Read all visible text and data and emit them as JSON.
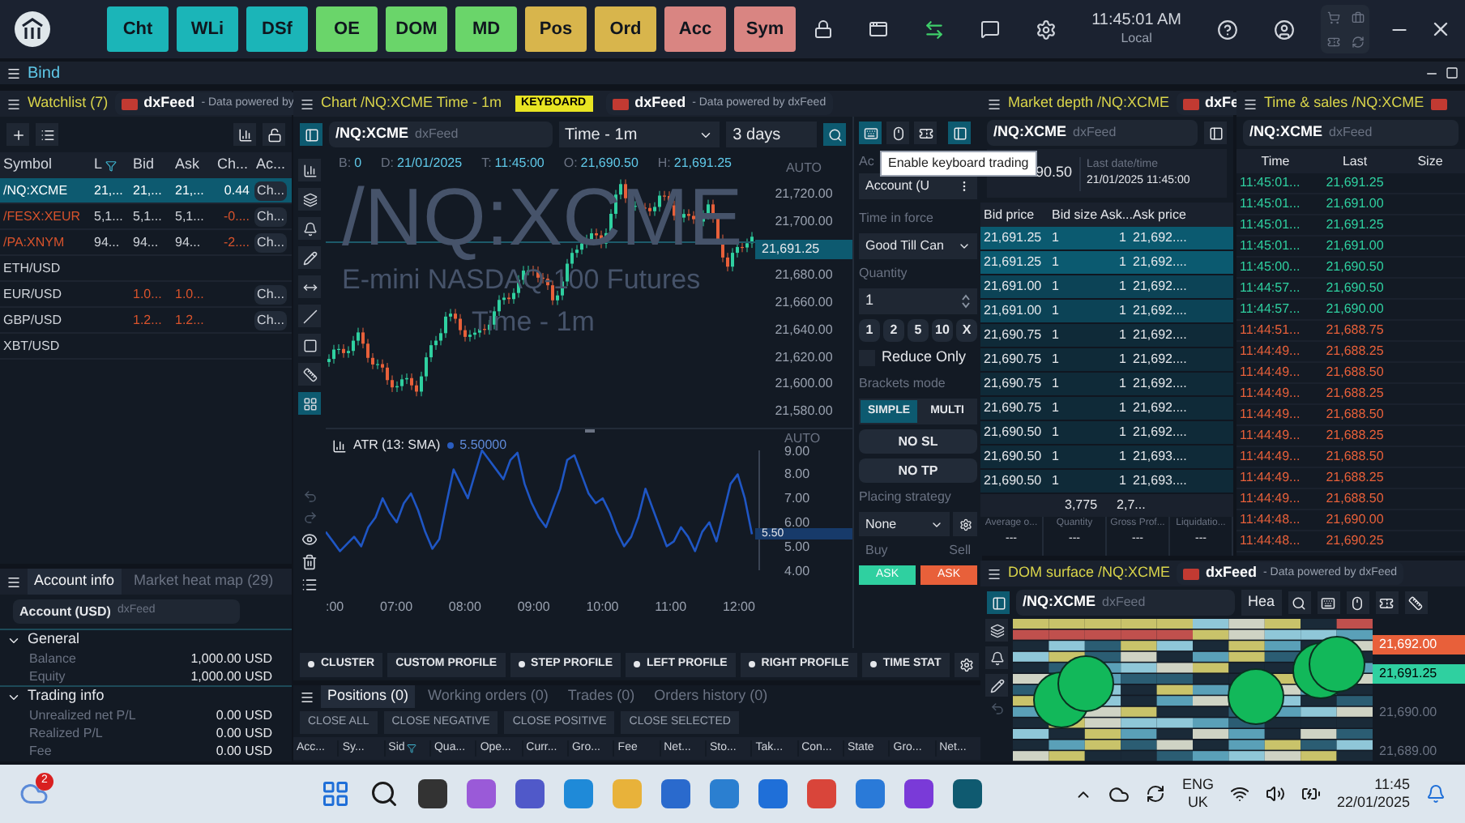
{
  "topbar": {
    "modules": [
      {
        "label": "Cht",
        "color": "#1bb5b8"
      },
      {
        "label": "WLi",
        "color": "#1bb5b8"
      },
      {
        "label": "DSf",
        "color": "#1bb5b8"
      },
      {
        "label": "OE",
        "color": "#6ad56a"
      },
      {
        "label": "DOM",
        "color": "#6ad56a"
      },
      {
        "label": "MD",
        "color": "#6ad56a"
      },
      {
        "label": "Pos",
        "color": "#d8b54c"
      },
      {
        "label": "Ord",
        "color": "#d8b54c"
      },
      {
        "label": "Acc",
        "color": "#d98582"
      },
      {
        "label": "Sym",
        "color": "#d98582"
      }
    ],
    "clock": {
      "time": "11:45:01 AM",
      "zone": "Local"
    }
  },
  "workspace": {
    "title": "Bind"
  },
  "watchlist": {
    "title": "Watchlist (7)",
    "feed": "dxFeed",
    "feed_note": "- Data powered by",
    "columns": [
      "Symbol",
      "L",
      "Bid",
      "Ask",
      "Ch...",
      "Ac..."
    ],
    "rows": [
      {
        "symbol": "/NQ:XCME",
        "last": "21,...",
        "bid": "21,...",
        "ask": "21,...",
        "change": "0.44",
        "action": "Ch...",
        "selected": true,
        "color": "#ffffff",
        "quote_down": false,
        "change_down": false
      },
      {
        "symbol": "/FESX:XEUR",
        "last": "5,1...",
        "bid": "5,1...",
        "ask": "5,1...",
        "change": "-0....",
        "action": "Ch...",
        "selected": false,
        "color": "#d8532c",
        "quote_down": false,
        "change_down": true
      },
      {
        "symbol": "/PA:XNYM",
        "last": "94...",
        "bid": "94...",
        "ask": "94...",
        "change": "-2....",
        "action": "Ch...",
        "selected": false,
        "color": "#d8532c",
        "quote_down": false,
        "change_down": true
      },
      {
        "symbol": "ETH/USD",
        "selected": false,
        "color": "#d0d4da"
      },
      {
        "symbol": "EUR/USD",
        "bid": "1.0...",
        "ask": "1.0...",
        "action": "Ch...",
        "selected": false,
        "color": "#d0d4da",
        "quote_down": true
      },
      {
        "symbol": "GBP/USD",
        "bid": "1.2...",
        "ask": "1.2...",
        "action": "Ch...",
        "selected": false,
        "color": "#d0d4da",
        "quote_down": true
      },
      {
        "symbol": "XBT/USD",
        "selected": false,
        "color": "#d0d4da"
      }
    ]
  },
  "account": {
    "tabs": [
      {
        "label": "Account info",
        "selected": true
      },
      {
        "label": "Market heat map (29)",
        "selected": false
      }
    ],
    "account": "Account (USD)",
    "source": "dxFeed",
    "groups": [
      {
        "title": "General",
        "expanded": true,
        "items": [
          {
            "label": "Balance",
            "value": "1,000.00 USD"
          },
          {
            "label": "Equity",
            "value": "1,000.00 USD"
          }
        ]
      },
      {
        "title": "Trading info",
        "expanded": true,
        "items": [
          {
            "label": "Unrealized net P/L",
            "value": "0.00 USD"
          },
          {
            "label": "Realized P/L",
            "value": "0.00 USD"
          },
          {
            "label": "Fee",
            "value": "0.00 USD"
          }
        ]
      }
    ]
  },
  "chart": {
    "title": "Chart /NQ:XCME Time - 1m",
    "badge": "KEYBOARD",
    "feed": "dxFeed",
    "feed_note": "- Data powered by dxFeed",
    "symbol": "/NQ:XCME",
    "symbol_source": "dxFeed",
    "interval": "Time - 1m",
    "range": "3 days",
    "info": [
      {
        "key": "B:",
        "value": "0"
      },
      {
        "key": "D:",
        "value": "21/01/2025"
      },
      {
        "key": "T:",
        "value": "11:45:00"
      },
      {
        "key": "O:",
        "value": "21,690.50"
      },
      {
        "key": "H:",
        "value": "21,691.25"
      }
    ],
    "watermark": {
      "symbol": "/NQ:XCME",
      "name": "E-mini NASDAQ-100 Futures",
      "interval": "Time - 1m"
    },
    "price_axis": {
      "mode": "AUTO",
      "ticks": [
        "21,720.00",
        "21,700.00",
        "21,680.00",
        "21,660.00",
        "21,640.00",
        "21,620.00",
        "21,600.00",
        "21,580.00"
      ],
      "current": "21,691.25"
    },
    "indicator": {
      "value": "5.50000",
      "mode": "AUTO",
      "current": "5.50",
      "chart_data": {
        "type": "line",
        "ylim": [
          4,
          9
        ],
        "yticks": [
          {
            "value": 9,
            "label": "9.00"
          },
          {
            "value": 8,
            "label": "8.00"
          },
          {
            "value": 7,
            "label": "7.00"
          },
          {
            "value": 6,
            "label": "6.00"
          },
          {
            "value": 5,
            "label": "5.00"
          },
          {
            "value": 4,
            "label": "4.00"
          }
        ],
        "series": [
          {
            "name": "ATR (13: SMA)",
            "color": "#1f56c4",
            "values": [
              5.6,
              5.2,
              4.8,
              5.1,
              5.4,
              5.0,
              5.8,
              6.2,
              7.0,
              6.4,
              6.0,
              6.8,
              7.2,
              6.5,
              5.6,
              4.9,
              5.3,
              6.8,
              8.2,
              7.6,
              7.0,
              8.0,
              9.0,
              8.6,
              8.2,
              7.8,
              8.6,
              8.9,
              7.6,
              6.8,
              6.2,
              5.8,
              6.6,
              7.4,
              8.6,
              8.8,
              8.0,
              7.2,
              6.8,
              7.0,
              6.4,
              5.6,
              5.0,
              5.4,
              6.2,
              7.4,
              6.6,
              5.8,
              5.0,
              5.2,
              5.8,
              5.4,
              4.8,
              5.6,
              6.0,
              5.2,
              6.4,
              7.6,
              8.0,
              7.0,
              5.5
            ]
          }
        ]
      }
    },
    "time_ticks": [
      ":00",
      "07:00",
      "08:00",
      "09:00",
      "10:00",
      "11:00",
      "12:00"
    ],
    "profiles": [
      {
        "label": "CLUSTER",
        "dot": true
      },
      {
        "label": "CUSTOM PROFILE",
        "dot": false
      },
      {
        "label": "STEP PROFILE",
        "dot": true
      },
      {
        "label": "LEFT PROFILE",
        "dot": true
      },
      {
        "label": "RIGHT PROFILE",
        "dot": true
      },
      {
        "label": "TIME STAT",
        "dot": true
      }
    ]
  },
  "order_entry": {
    "keyboard_trading": true,
    "tooltip": "Enable keyboard trading",
    "account_label": "Ac",
    "account": "Account (U",
    "tif_label": "Time in force",
    "tif": "Good Till Can",
    "quantity_label": "Quantity",
    "quantity": "1",
    "presets": [
      "1",
      "2",
      "5",
      "10",
      "X"
    ],
    "reduce_only": {
      "label": "Reduce Only",
      "checked": false
    },
    "brackets_label": "Brackets mode",
    "brackets": [
      {
        "label": "SIMPLE",
        "selected": true
      },
      {
        "label": "MULTI",
        "selected": false
      }
    ],
    "stop_loss": "NO SL",
    "take_profit": "NO TP",
    "strategy_label": "Placing strategy",
    "strategy": "None",
    "buy_label": "Buy",
    "sell_label": "Sell",
    "buy": "ASK",
    "sell": "ASK"
  },
  "market_depth": {
    "title": "Market depth /NQ:XCME",
    "feed": "dxFe",
    "symbol": "/NQ:XCME",
    "symbol_source": "dxFeed",
    "last_price": "90.50",
    "last_time_label": "Last date/time",
    "last_time": "21/01/2025 11:45:00",
    "columns": [
      "Bid price",
      "Bid size",
      "Ask...",
      "Ask price"
    ],
    "rows": [
      {
        "bid": "21,691.25",
        "bid_size": "1",
        "ask_size": "1",
        "ask": "21,692....",
        "kind": "top"
      },
      {
        "bid": "21,691.25",
        "bid_size": "1",
        "ask_size": "1",
        "ask": "21,692....",
        "kind": "top"
      },
      {
        "bid": "21,691.00",
        "bid_size": "1",
        "ask_size": "1",
        "ask": "21,692....",
        "kind": "near"
      },
      {
        "bid": "21,691.00",
        "bid_size": "1",
        "ask_size": "1",
        "ask": "21,692....",
        "kind": "near"
      },
      {
        "bid": "21,690.75",
        "bid_size": "1",
        "ask_size": "1",
        "ask": "21,692....",
        "kind": "plain"
      },
      {
        "bid": "21,690.75",
        "bid_size": "1",
        "ask_size": "1",
        "ask": "21,692....",
        "kind": "plain"
      },
      {
        "bid": "21,690.75",
        "bid_size": "1",
        "ask_size": "1",
        "ask": "21,692....",
        "kind": "plain"
      },
      {
        "bid": "21,690.75",
        "bid_size": "1",
        "ask_size": "1",
        "ask": "21,692....",
        "kind": "plain"
      },
      {
        "bid": "21,690.50",
        "bid_size": "1",
        "ask_size": "1",
        "ask": "21,692....",
        "kind": "plain"
      },
      {
        "bid": "21,690.50",
        "bid_size": "1",
        "ask_size": "1",
        "ask": "21,693....",
        "kind": "plain"
      },
      {
        "bid": "21,690.50",
        "bid_size": "1",
        "ask_size": "1",
        "ask": "21,693....",
        "kind": "plain"
      }
    ],
    "totals": [
      "3,775",
      "2,7..."
    ],
    "stats": [
      {
        "label": "Average o...",
        "value": "---"
      },
      {
        "label": "Quantity",
        "value": "---"
      },
      {
        "label": "Gross Prof...",
        "value": "---"
      },
      {
        "label": "Liquidatio...",
        "value": "---"
      }
    ]
  },
  "time_sales": {
    "title": "Time & sales /NQ:XCME",
    "symbol": "/NQ:XCME",
    "symbol_source": "dxFeed",
    "columns": [
      "Time",
      "Last",
      "Size"
    ],
    "rows": [
      {
        "time": "11:45:01...",
        "last": "21,691.25",
        "color": "#2fd0a0"
      },
      {
        "time": "11:45:01...",
        "last": "21,691.00",
        "color": "#2fd0a0"
      },
      {
        "time": "11:45:01...",
        "last": "21,691.25",
        "color": "#2fd0a0"
      },
      {
        "time": "11:45:01...",
        "last": "21,691.00",
        "color": "#2fd0a0"
      },
      {
        "time": "11:45:00...",
        "last": "21,690.50",
        "color": "#2fd0a0"
      },
      {
        "time": "11:44:57...",
        "last": "21,690.50",
        "color": "#2fd0a0"
      },
      {
        "time": "11:44:57...",
        "last": "21,690.00",
        "color": "#2fd0a0"
      },
      {
        "time": "11:44:51...",
        "last": "21,688.75",
        "color": "#e8603a"
      },
      {
        "time": "11:44:49...",
        "last": "21,688.25",
        "color": "#e8603a"
      },
      {
        "time": "11:44:49...",
        "last": "21,688.50",
        "color": "#e8603a"
      },
      {
        "time": "11:44:49...",
        "last": "21,688.25",
        "color": "#e8603a"
      },
      {
        "time": "11:44:49...",
        "last": "21,688.50",
        "color": "#e8603a"
      },
      {
        "time": "11:44:49...",
        "last": "21,688.25",
        "color": "#e8603a"
      },
      {
        "time": "11:44:49...",
        "last": "21,688.50",
        "color": "#e8603a"
      },
      {
        "time": "11:44:49...",
        "last": "21,688.25",
        "color": "#e8603a"
      },
      {
        "time": "11:44:49...",
        "last": "21,688.50",
        "color": "#e8603a"
      },
      {
        "time": "11:44:48...",
        "last": "21,690.00",
        "color": "#e8603a"
      },
      {
        "time": "11:44:48...",
        "last": "21,690.25",
        "color": "#e8603a"
      }
    ]
  },
  "positions": {
    "tabs": [
      {
        "label": "Positions (0)",
        "selected": true
      },
      {
        "label": "Working orders (0)",
        "selected": false
      },
      {
        "label": "Trades (0)",
        "selected": false
      },
      {
        "label": "Orders history (0)",
        "selected": false
      }
    ],
    "actions": [
      "CLOSE ALL",
      "CLOSE NEGATIVE",
      "CLOSE POSITIVE",
      "CLOSE SELECTED"
    ],
    "columns": [
      "Acc...",
      "Sy...",
      "Sid",
      "Qua...",
      "Ope...",
      "Curr...",
      "Gro...",
      "Fee",
      "Net...",
      "Sto...",
      "Tak...",
      "Con...",
      "State",
      "Gro...",
      "Net..."
    ]
  },
  "dom_surface": {
    "title": "DOM surface /NQ:XCME",
    "feed": "dxFeed",
    "feed_note": "- Data powered by dxFeed",
    "symbol": "/NQ:XCME",
    "symbol_source": "dxFeed",
    "mode": "Hea",
    "price_labels": [
      {
        "label": "21,692.00",
        "kind": "ask"
      },
      {
        "label": "21,691.25",
        "kind": "last"
      },
      {
        "label": "21,690.00",
        "kind": "plain"
      },
      {
        "label": "21,689.00",
        "kind": "plain"
      }
    ]
  },
  "taskbar": {
    "weather_badge": "2",
    "language": "ENG",
    "region": "UK",
    "time": "11:45",
    "date": "22/01/2025"
  }
}
